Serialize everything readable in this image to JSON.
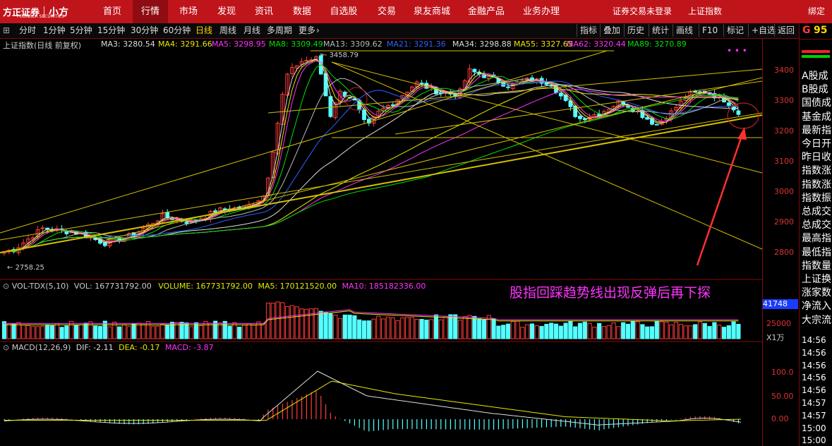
{
  "nav": {
    "brand": "方正证券",
    "brand_sub": "FOUNDER SECURITIES",
    "app_name": "小方",
    "items": [
      "首页",
      "行情",
      "市场",
      "发现",
      "资讯",
      "数据",
      "自选股",
      "交易",
      "泉友商城",
      "金融产品",
      "业务办理"
    ],
    "active_index": 1,
    "login_status": "证券交易未登录",
    "index_name": "上证指数",
    "bind": "绑定手"
  },
  "toolbar": {
    "periods": [
      "分时",
      "1分钟",
      "5分钟",
      "15分钟",
      "30分钟",
      "60分钟",
      "日线",
      "周线",
      "月线",
      "多周期",
      "更多"
    ],
    "active_period": "日线",
    "right": [
      "指标",
      "叠加",
      "历史",
      "统计",
      "画线",
      "F10",
      "标记",
      "+自选",
      "返回"
    ]
  },
  "chart_header": {
    "title": "上证指数(日线 前复权)",
    "ma": [
      {
        "label": "MA3: 3280.54",
        "color": "#dddddd"
      },
      {
        "label": "MA4: 3291.66",
        "color": "#e8e800"
      },
      {
        "label": "MA5: 3298.95",
        "color": "#ff33ff"
      },
      {
        "label": "MA8: 3309.49",
        "color": "#00e000"
      },
      {
        "label": "MA13: 3309.62",
        "color": "#bbbbbb"
      },
      {
        "label": "MA21: 3291.36",
        "color": "#3060ff"
      },
      {
        "label": "MA34: 3298.88",
        "color": "#dddddd"
      },
      {
        "label": "MA55: 3327.65",
        "color": "#e8e800"
      },
      {
        "label": "MA62: 3320.44",
        "color": "#ff33ff"
      },
      {
        "label": "MA89: 3270.89",
        "color": "#00e000"
      }
    ],
    "high_label": "3458.79",
    "low_label": "2758.25"
  },
  "price_axis": [
    "3400",
    "3300",
    "3200",
    "3100",
    "3000",
    "2900",
    "2800"
  ],
  "annotation": "股指回踩趋势线出现反弹后再下探",
  "volume_header": {
    "name": "VOL-TDX(5,10)",
    "vol": "VOL: 167731792.00",
    "volume": "VOLUME: 167731792.00",
    "ma5": "MA5: 170121520.00",
    "ma10": "MA10: 185182336.00"
  },
  "volume_axis": {
    "top": "41748",
    "mid": "25000",
    "unit": "X1万"
  },
  "macd_header": {
    "name": "MACD(12,26,9)",
    "dif": "DIF: -2.11",
    "dea": "DEA: -0.17",
    "macd": "MACD: -3.87"
  },
  "macd_axis": [
    "100.0",
    "50.00",
    "0.00"
  ],
  "right_panel": {
    "code_letter": "G",
    "code_num": "95",
    "rows": [
      "A股成",
      "B股成",
      "国债成",
      "基金成",
      "最新指",
      "今日开",
      "昨日收",
      "指数涨",
      "指数涨",
      "指数振",
      "总成交",
      "总成交",
      "最高指",
      "最低指",
      "指数量",
      "上证换",
      "涨家数",
      "净流入",
      "大宗流"
    ],
    "times": [
      "14:56",
      "14:56",
      "14:56",
      "14:56",
      "14:56",
      "14:57",
      "14:57",
      "15:00",
      "15:00"
    ]
  },
  "colors": {
    "up": "#ff3b3b",
    "down": "#54ffff",
    "nav": "#c0141b",
    "annotation": "#ff33ff"
  }
}
